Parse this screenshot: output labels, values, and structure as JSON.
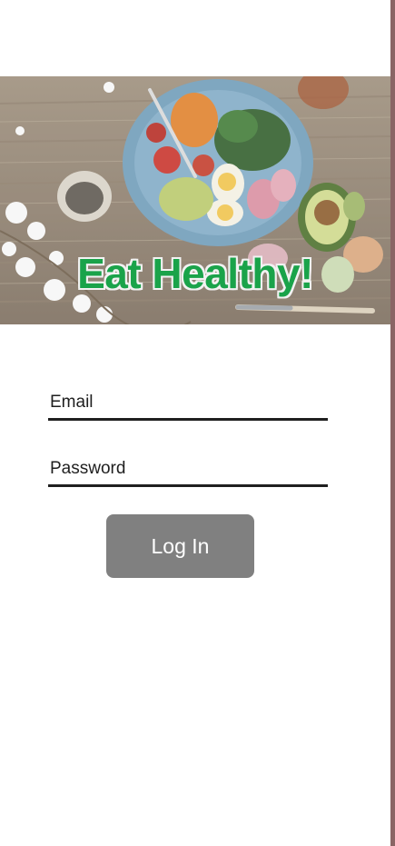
{
  "hero": {
    "title": "Eat Healthy!"
  },
  "login_form": {
    "email_placeholder": "Email",
    "password_placeholder": "Password",
    "login_label": "Log In"
  },
  "colors": {
    "title_green": "#1aa34a",
    "button_gray": "#808080",
    "underline": "#1f1f1f",
    "side_border": "#8a6565"
  }
}
